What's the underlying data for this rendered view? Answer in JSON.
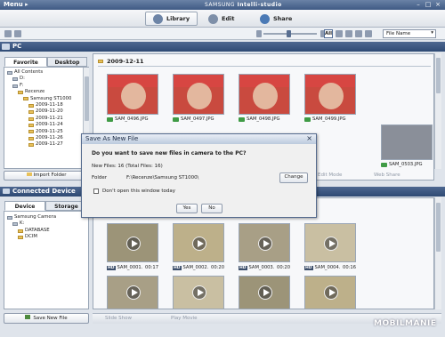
{
  "window": {
    "menu_label": "Menu ▸",
    "brand": "SAMSUNG",
    "app_name": "Intelli-studio"
  },
  "modes": [
    {
      "label": "Library",
      "icon": "library-icon"
    },
    {
      "label": "Edit",
      "icon": "edit-icon"
    },
    {
      "label": "Share",
      "icon": "share-icon"
    }
  ],
  "toolbar": {
    "all_label": "All",
    "sort_value": "File Name"
  },
  "pc_section": {
    "title": "PC",
    "tabs": [
      "Favorite",
      "Desktop"
    ],
    "tree": [
      {
        "label": "All Contents",
        "indent": 0,
        "kind": "drive"
      },
      {
        "label": "D:",
        "indent": 1,
        "kind": "drive"
      },
      {
        "label": "F:",
        "indent": 1,
        "kind": "drive"
      },
      {
        "label": "Recenze",
        "indent": 2,
        "kind": "folder"
      },
      {
        "label": "Samsung ST1000",
        "indent": 3,
        "kind": "folder"
      },
      {
        "label": "2009-11-18",
        "indent": 4,
        "kind": "folder"
      },
      {
        "label": "2009-11-20",
        "indent": 4,
        "kind": "folder"
      },
      {
        "label": "2009-11-21",
        "indent": 4,
        "kind": "folder"
      },
      {
        "label": "2009-11-24",
        "indent": 4,
        "kind": "folder"
      },
      {
        "label": "2009-11-25",
        "indent": 4,
        "kind": "folder"
      },
      {
        "label": "2009-11-26",
        "indent": 4,
        "kind": "folder"
      },
      {
        "label": "2009-11-27",
        "indent": 4,
        "kind": "folder"
      }
    ],
    "import_button": "Import Folder",
    "folder_date": "2009-12-11",
    "photos": [
      "SAM_0496.JPG",
      "SAM_0497.JPG",
      "SAM_0498.JPG",
      "SAM_0499.JPG"
    ],
    "photo_right": "SAM_0503.JPG",
    "edit_mode": "Edit Mode",
    "web_share": "Web Share"
  },
  "device_section": {
    "title": "Connected Device",
    "tabs": [
      "Device",
      "Storage"
    ],
    "tree": [
      {
        "label": "Samsung Camera",
        "indent": 0,
        "kind": "drive"
      },
      {
        "label": "K:",
        "indent": 1,
        "kind": "drive"
      },
      {
        "label": "DATABASE",
        "indent": 2,
        "kind": "folder"
      },
      {
        "label": "DCIM",
        "indent": 2,
        "kind": "folder"
      }
    ],
    "save_button": "Save New File",
    "videos": [
      {
        "name": "SAM_0001.",
        "time": "00:17"
      },
      {
        "name": "SAM_0002.",
        "time": "00:20"
      },
      {
        "name": "SAM_0003.",
        "time": "00:20"
      },
      {
        "name": "SAM_0004.",
        "time": "00:16"
      }
    ],
    "slide_show": "Slide Show",
    "play_movie": "Play Movie"
  },
  "dialog": {
    "title": "Save As New File",
    "question": "Do you want to save new files in camera to the PC?",
    "new_files": "New Files: 16 (Total Files: 16)",
    "folder_label": "Folder",
    "folder_path": "F:\\Recenze\\Samsung ST1000\\",
    "change_button": "Change",
    "checkbox_label": "Don't open this window today",
    "yes": "Yes",
    "no": "No"
  },
  "watermark": "MOBILMANIE"
}
